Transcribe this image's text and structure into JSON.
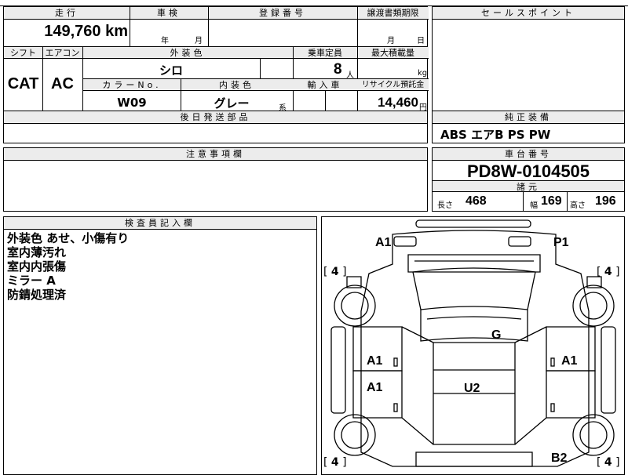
{
  "top": {
    "labels": {
      "mileage": "走行",
      "inspection": "車検",
      "registration": "登録番号",
      "transfer_deadline": "譲渡書類期限",
      "sales_point": "セールスポイント",
      "shift": "シフト",
      "aircon": "エアコン",
      "exterior_color": "外装色",
      "capacity": "乗車定員",
      "max_load": "最大積載量",
      "color_no": "カラーNo.",
      "interior_color": "内装色",
      "import": "輸入車",
      "recycle": "リサイクル預託金",
      "later_parts": "後日発送部品",
      "genuine_equipment": "純正装備",
      "notes": "注意事項欄",
      "chassis_no": "車台番号",
      "specs": "諸元",
      "inspector": "検査員記入欄"
    },
    "mileage": "149,760 km",
    "inspection_year": "年",
    "inspection_month": "月",
    "transfer_month": "月",
    "transfer_day": "日",
    "shift": "CAT",
    "aircon": "AC",
    "exterior_color": "シロ",
    "capacity": "8",
    "capacity_unit": "人",
    "max_load_unit": "kg",
    "color_no": "W09",
    "interior_color": "グレー",
    "interior_suffix": "系",
    "recycle": "14,460",
    "recycle_unit": "円"
  },
  "equipment": "ABS エアB PS PW",
  "chassis_no": "PD8W-0104505",
  "specs": {
    "length_label": "長さ",
    "length": "468",
    "width_label": "幅",
    "width": "169",
    "height_label": "高さ",
    "height": "196"
  },
  "inspector_notes": [
    "外装色 あせ、小傷有り",
    "室内薄汚れ",
    "室内内張傷",
    "ミラー A",
    "防錆処理済"
  ],
  "diagram": {
    "marks": {
      "front_left": "A1",
      "front_right": "P1",
      "roof": "G",
      "left_front_door": "A1",
      "left_rear_door": "A1",
      "right_front_door": "A1",
      "floor": "U2",
      "rear_right": "B2"
    },
    "tires": {
      "front_left": "4",
      "front_right": "4",
      "rear_left": "4",
      "rear_right": "4"
    }
  }
}
